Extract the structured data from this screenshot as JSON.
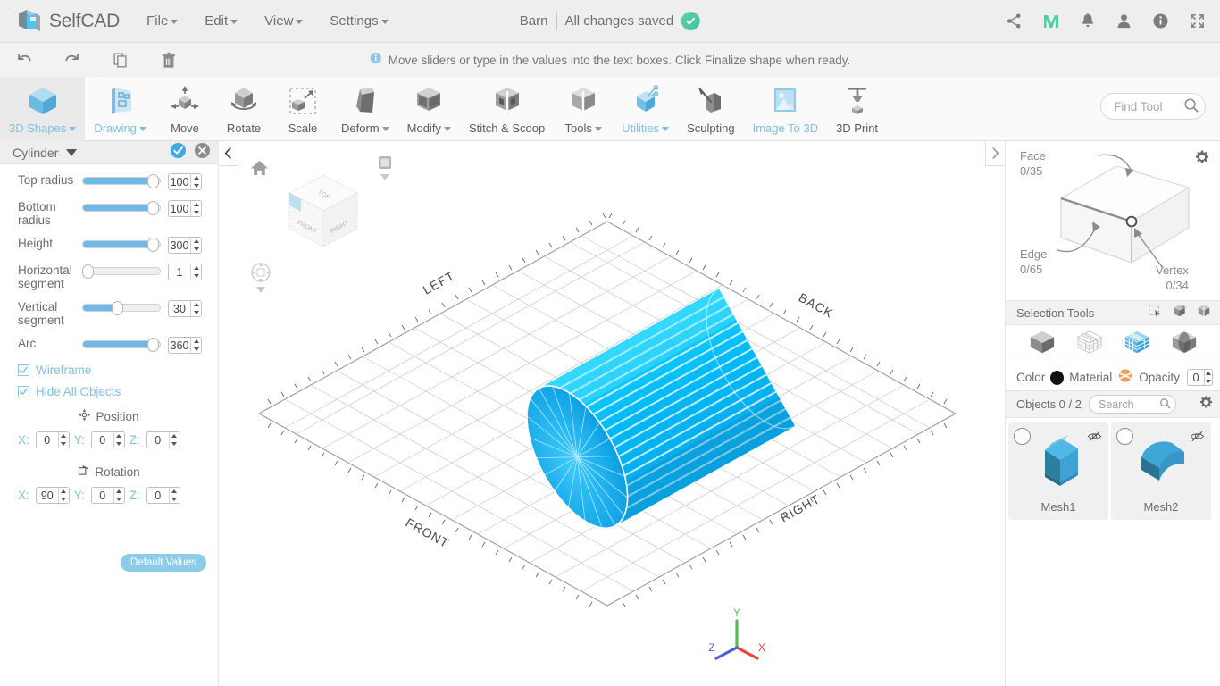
{
  "topbar": {
    "brand": "SelfCAD",
    "menus": [
      {
        "label": "File"
      },
      {
        "label": "Edit"
      },
      {
        "label": "View"
      },
      {
        "label": "Settings"
      }
    ],
    "doc_title": "Barn",
    "save_status": "All changes saved",
    "right_icons": [
      {
        "name": "share-icon"
      },
      {
        "name": "medium-logo-icon"
      },
      {
        "name": "notifications-bell-icon"
      },
      {
        "name": "user-account-icon"
      },
      {
        "name": "info-icon"
      },
      {
        "name": "fullscreen-icon"
      }
    ]
  },
  "secondbar": {
    "history": [
      {
        "name": "undo-button"
      },
      {
        "name": "redo-button"
      },
      {
        "name": "copy-button"
      },
      {
        "name": "delete-button"
      }
    ],
    "hint": "Move sliders or type in the values into the text boxes. Click Finalize shape when ready."
  },
  "ribbon": {
    "tools": [
      {
        "label": "3D Shapes",
        "dropdown": true,
        "highlight": true,
        "active": true
      },
      {
        "label": "Drawing",
        "dropdown": true,
        "highlight": true,
        "active": false
      },
      {
        "label": "Move",
        "dropdown": false,
        "highlight": false,
        "active": false
      },
      {
        "label": "Rotate",
        "dropdown": false,
        "highlight": false,
        "active": false
      },
      {
        "label": "Scale",
        "dropdown": false,
        "highlight": false,
        "active": false
      },
      {
        "label": "Deform",
        "dropdown": true,
        "highlight": false,
        "active": false
      },
      {
        "label": "Modify",
        "dropdown": true,
        "highlight": false,
        "active": false
      },
      {
        "label": "Stitch & Scoop",
        "dropdown": false,
        "highlight": false,
        "active": false
      },
      {
        "label": "Tools",
        "dropdown": true,
        "highlight": false,
        "active": false
      },
      {
        "label": "Utilities",
        "dropdown": true,
        "highlight": true,
        "active": false
      },
      {
        "label": "Sculpting",
        "dropdown": false,
        "highlight": false,
        "active": false
      },
      {
        "label": "Image To 3D",
        "dropdown": false,
        "highlight": true,
        "active": false
      },
      {
        "label": "3D Print",
        "dropdown": false,
        "highlight": false,
        "active": false
      }
    ],
    "find_tool_placeholder": "Find Tool"
  },
  "left_panel": {
    "title": "Cylinder",
    "sliders": [
      {
        "label": "Top radius",
        "value": "100",
        "fill_pct": 88
      },
      {
        "label": "Bottom radius",
        "value": "100",
        "fill_pct": 88
      },
      {
        "label": "Height",
        "value": "300",
        "fill_pct": 88
      },
      {
        "label": "Horizontal segment",
        "value": "1",
        "fill_pct": 0
      },
      {
        "label": "Vertical segment",
        "value": "30",
        "fill_pct": 43
      },
      {
        "label": "Arc",
        "value": "360",
        "fill_pct": 88
      }
    ],
    "checkboxes": [
      {
        "label": "Wireframe",
        "checked": true
      },
      {
        "label": "Hide All Objects",
        "checked": true
      }
    ],
    "position": {
      "title": "Position",
      "x": "0",
      "y": "0",
      "z": "0"
    },
    "rotation": {
      "title": "Rotation",
      "x": "90",
      "y": "0",
      "z": "0"
    },
    "default_button": "Default Values"
  },
  "viewport": {
    "cube_faces": {
      "top": "TOP",
      "front": "FRONT",
      "right": "RIGHT"
    },
    "grid_labels": {
      "left": "LEFT",
      "back": "BACK",
      "front": "FRONT",
      "right": "RIGHT"
    },
    "axis": {
      "x": "X",
      "y": "Y",
      "z": "Z",
      "x_color": "#e03131",
      "y_color": "#2f9e44",
      "z_color": "#3b5bdb"
    },
    "object_color": "#00b0f0"
  },
  "right_panel": {
    "counters": [
      {
        "label": "Face",
        "value": "0/35"
      },
      {
        "label": "Edge",
        "value": "0/65"
      },
      {
        "label": "Vertex",
        "value": "0/34"
      }
    ],
    "selection_tools_label": "Selection Tools",
    "selection_tool_icons": [
      {
        "name": "rect-select-icon"
      },
      {
        "name": "magic-select-icon"
      },
      {
        "name": "loop-select-icon"
      }
    ],
    "selection_modes": [
      {
        "name": "object-mode-icon",
        "active": false
      },
      {
        "name": "vertex-mode-icon",
        "active": false
      },
      {
        "name": "face-mode-icon",
        "active": true
      },
      {
        "name": "edge-mode-icon",
        "active": false
      }
    ],
    "material_row": {
      "color_label": "Color",
      "color_value": "#111111",
      "material_label": "Material",
      "opacity_label": "Opacity",
      "opacity_value": "0"
    },
    "objects_header": {
      "label": "Objects 0 / 2",
      "search_placeholder": "Search"
    },
    "objects": [
      {
        "name": "Mesh1",
        "selected": false,
        "hidden": true
      },
      {
        "name": "Mesh2",
        "selected": false,
        "hidden": true
      }
    ]
  }
}
